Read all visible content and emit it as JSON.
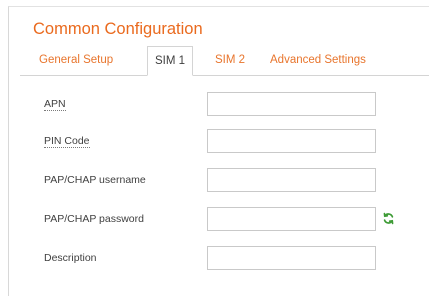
{
  "section": {
    "title": "Common Configuration"
  },
  "tabs": [
    {
      "label": "General Setup",
      "active": false
    },
    {
      "label": "SIM 1",
      "active": true
    },
    {
      "label": "SIM 2",
      "active": false
    },
    {
      "label": "Advanced Settings",
      "active": false
    }
  ],
  "form": {
    "apn": {
      "label": "APN",
      "value": ""
    },
    "pin_code": {
      "label": "PIN Code",
      "value": ""
    },
    "pap_chap_username": {
      "label": "PAP/CHAP username",
      "value": ""
    },
    "pap_chap_password": {
      "label": "PAP/CHAP password",
      "value": ""
    },
    "description": {
      "label": "Description",
      "value": ""
    }
  },
  "icons": {
    "password_reveal": "refresh-icon"
  },
  "colors": {
    "accent": "#ea6a1e",
    "icon_green": "#3d9b35"
  }
}
